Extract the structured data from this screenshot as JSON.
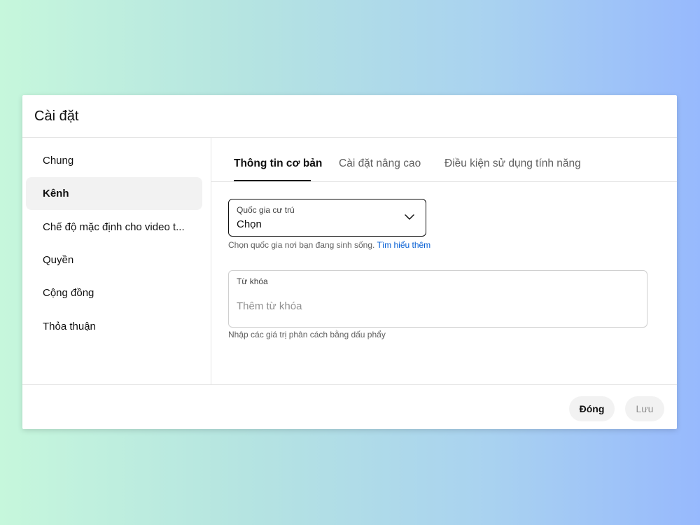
{
  "dialog": {
    "title": "Cài đặt"
  },
  "sidebar": {
    "items": [
      {
        "label": "Chung",
        "active": false
      },
      {
        "label": "Kênh",
        "active": true
      },
      {
        "label": "Chế độ mặc định cho video t...",
        "active": false
      },
      {
        "label": "Quyền",
        "active": false
      },
      {
        "label": "Cộng đồng",
        "active": false
      },
      {
        "label": "Thỏa thuận",
        "active": false
      }
    ]
  },
  "tabs": [
    {
      "label": "Thông tin cơ bản",
      "active": true
    },
    {
      "label": "Cài đặt nâng cao",
      "active": false
    },
    {
      "label": "Điều kiện sử dụng tính năng",
      "active": false
    }
  ],
  "country": {
    "label": "Quốc gia cư trú",
    "value": "Chọn",
    "helper": "Chọn quốc gia nơi bạn đang sinh sống.",
    "learn_more": "Tìm hiểu thêm",
    "icon": "chevron-down-icon"
  },
  "keywords": {
    "label": "Từ khóa",
    "placeholder": "Thêm từ khóa",
    "value": "",
    "helper": "Nhập các giá trị phân cách bằng dấu phẩy"
  },
  "footer": {
    "close_label": "Đóng",
    "save_label": "Lưu"
  },
  "colors": {
    "link": "#065fd4",
    "text": "#0f0f0f",
    "secondary_text": "#606060",
    "active_nav_bg": "#f2f2f2"
  }
}
